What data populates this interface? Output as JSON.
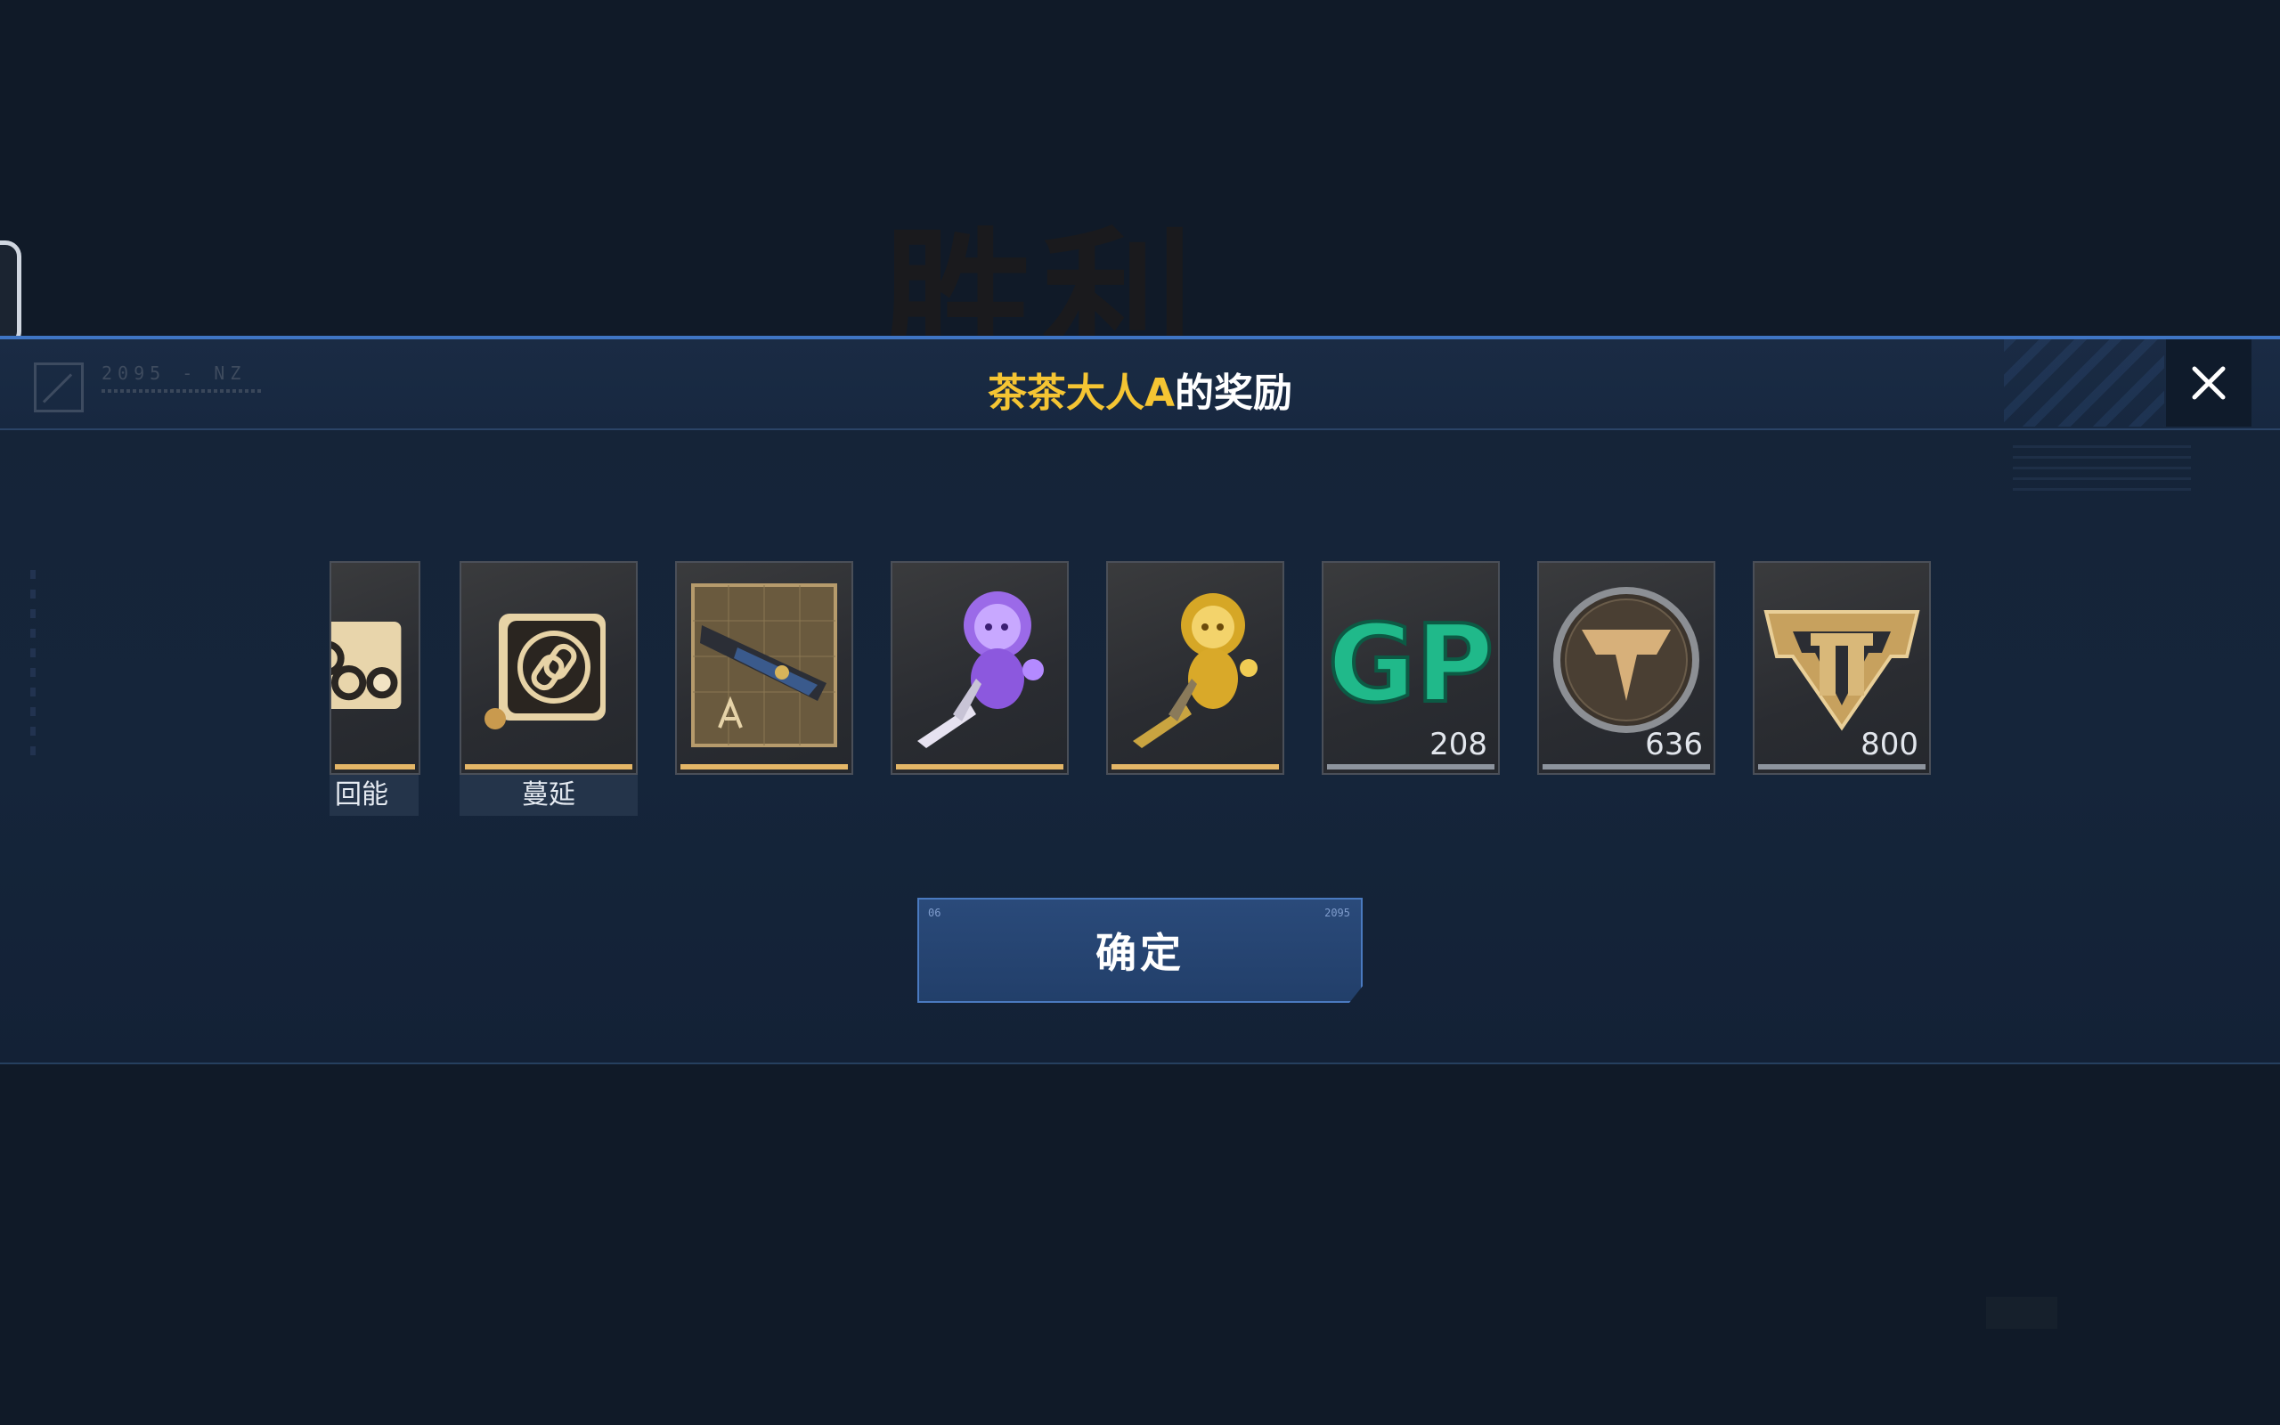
{
  "background": {
    "title": "胜利"
  },
  "header": {
    "brand_code": "2095 - NZ",
    "title_name": "茶茶大人A",
    "title_suffix": "的奖励",
    "close_icon": "close-icon"
  },
  "rewards": [
    {
      "label": "回能",
      "icon": "nodes-icon",
      "count": "",
      "bar": "gold"
    },
    {
      "label": "蔓延",
      "icon": "chain-link-icon",
      "count": "",
      "bar": "gold"
    },
    {
      "label": "",
      "icon": "weapon-blueprint-icon",
      "count": "",
      "bar": "gold"
    },
    {
      "label": "",
      "icon": "purple-spirit-icon",
      "count": "",
      "bar": "gold"
    },
    {
      "label": "",
      "icon": "gold-spirit-icon",
      "count": "",
      "bar": "gold"
    },
    {
      "label": "",
      "icon": "gp-currency-icon",
      "count": "208",
      "bar": "grey"
    },
    {
      "label": "",
      "icon": "bronze-emblem-icon",
      "count": "636",
      "bar": "grey"
    },
    {
      "label": "",
      "icon": "battle-pass-shield-icon",
      "count": "800",
      "bar": "grey"
    }
  ],
  "gp_text": "GP",
  "confirm": {
    "label": "确定",
    "tick_left": "06",
    "tick_right": "2095"
  },
  "colors": {
    "accent_gold": "#f5c533",
    "header_border": "#3f75c4",
    "button_bg": "#223f6a"
  }
}
